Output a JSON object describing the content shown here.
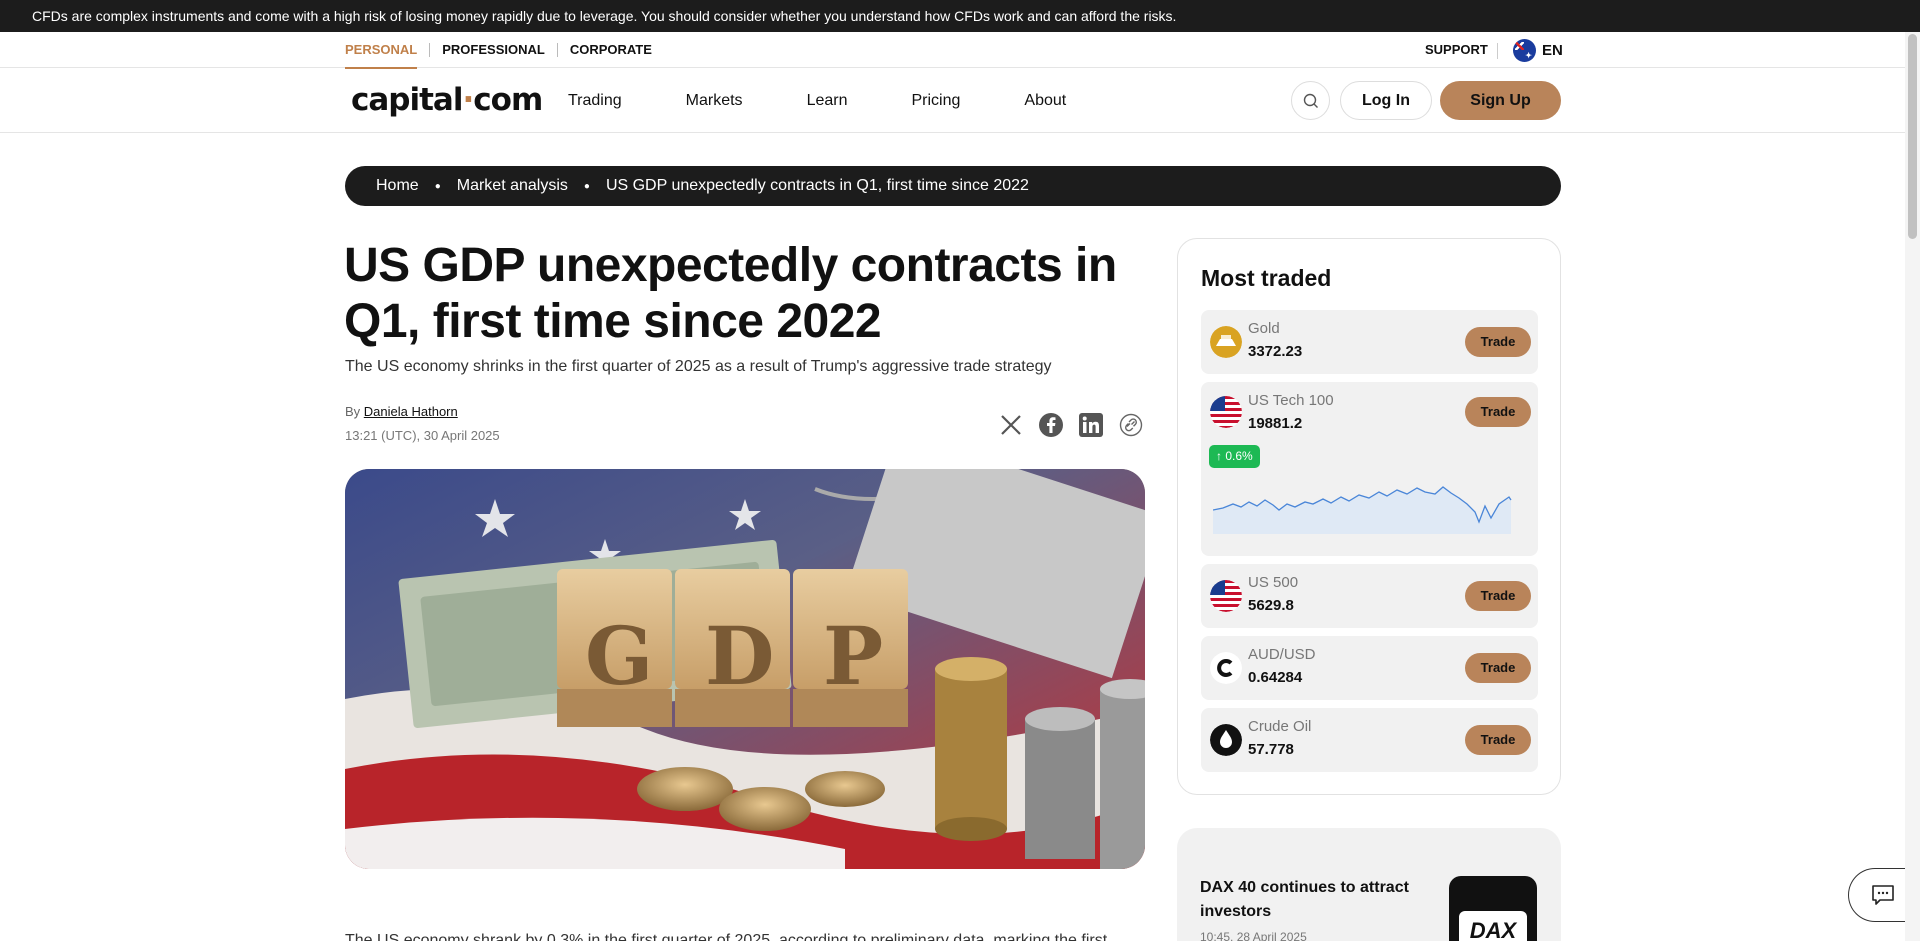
{
  "risk_warning": "CFDs are complex instruments and come with a high risk of losing money rapidly due to leverage. You should consider whether you understand how CFDs work and can afford the risks.",
  "segments": [
    "PERSONAL",
    "PROFESSIONAL",
    "CORPORATE"
  ],
  "support": "SUPPORT",
  "language": "EN",
  "logo": {
    "left": "capital",
    "dot": "·",
    "right": "com"
  },
  "nav": [
    "Trading",
    "Markets",
    "Learn",
    "Pricing",
    "About"
  ],
  "login": "Log In",
  "signup": "Sign Up",
  "breadcrumb": [
    "Home",
    "Market analysis",
    "US GDP unexpectedly contracts in Q1, first time since 2022"
  ],
  "article": {
    "title": "US GDP unexpectedly contracts in Q1, first time since 2022",
    "subtitle": "The US economy shrinks in the first quarter of 2025 as a result of Trump's aggressive trade strategy",
    "by": "By",
    "author": "Daniela Hathorn",
    "date": "13:21 (UTC), 30 April 2025",
    "first_line": "The US economy shrank by 0.3% in the first quarter of 2025, according to preliminary data, marking the first"
  },
  "most_traded": {
    "title": "Most traded",
    "trade_label": "Trade",
    "assets": [
      {
        "name": "Gold",
        "price": "3372.23",
        "icon": "gold-icon",
        "color": "#d9a322"
      },
      {
        "name": "US Tech 100",
        "price": "19881.2",
        "icon": "us-flag-icon",
        "change": "↑ 0.6%"
      },
      {
        "name": "US 500",
        "price": "5629.8",
        "icon": "us-flag-icon"
      },
      {
        "name": "AUD/USD",
        "price": "0.64284",
        "icon": "aud-usd-icon"
      },
      {
        "name": "Crude Oil",
        "price": "57.778",
        "icon": "oil-drop-icon"
      }
    ]
  },
  "dax_card": {
    "title": "DAX 40 continues to attract investors",
    "date": "10:45, 28 April 2025",
    "thumb_text": "DAX"
  },
  "colors": {
    "accent": "#c0804a",
    "button": "#b9845a",
    "dark": "#1c1c1c",
    "positive": "#1db954"
  }
}
